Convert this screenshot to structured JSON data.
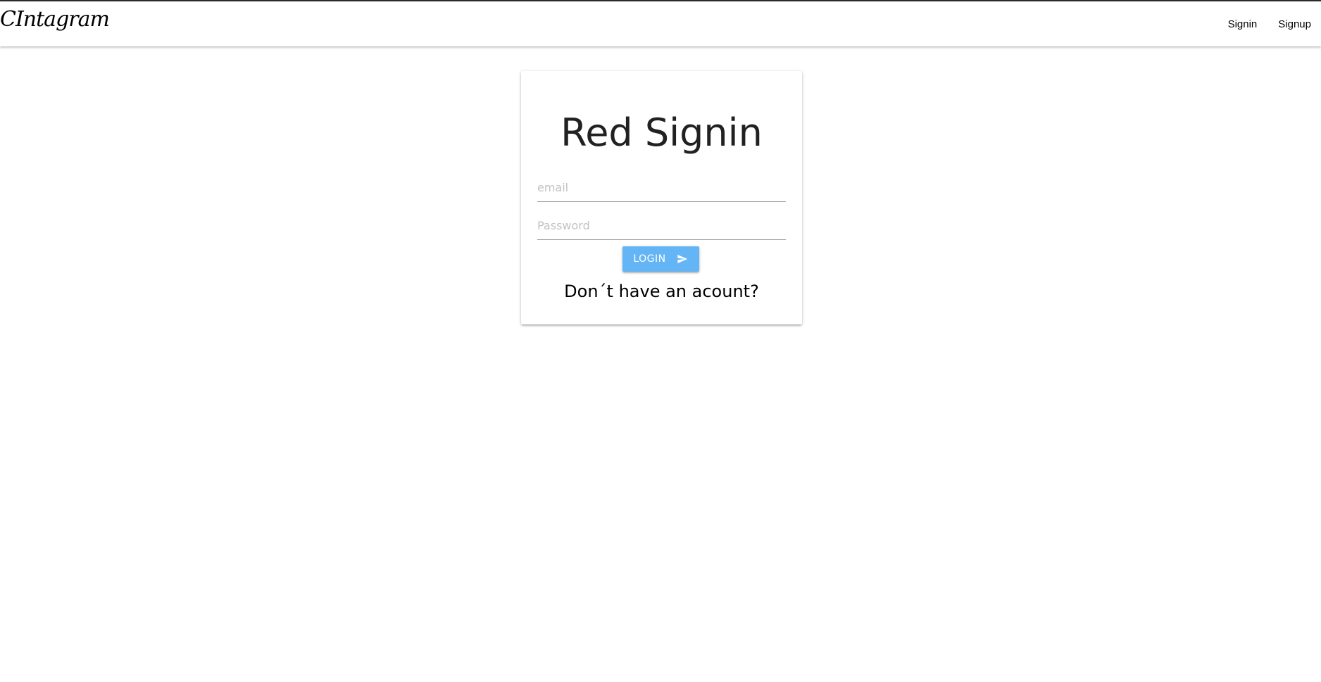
{
  "navbar": {
    "brand": "CIntagram",
    "links": [
      {
        "label": "Signin"
      },
      {
        "label": "Signup"
      }
    ]
  },
  "card": {
    "title": "Red Signin",
    "email": {
      "value": "",
      "placeholder": "email"
    },
    "password": {
      "value": "",
      "placeholder": "Password"
    },
    "login_label": "LOGIN",
    "login_icon": "send-icon",
    "signup_prompt": "Don´t have an acount?"
  },
  "colors": {
    "button": "#64b5f6",
    "top_border": "#2b2b2b"
  }
}
